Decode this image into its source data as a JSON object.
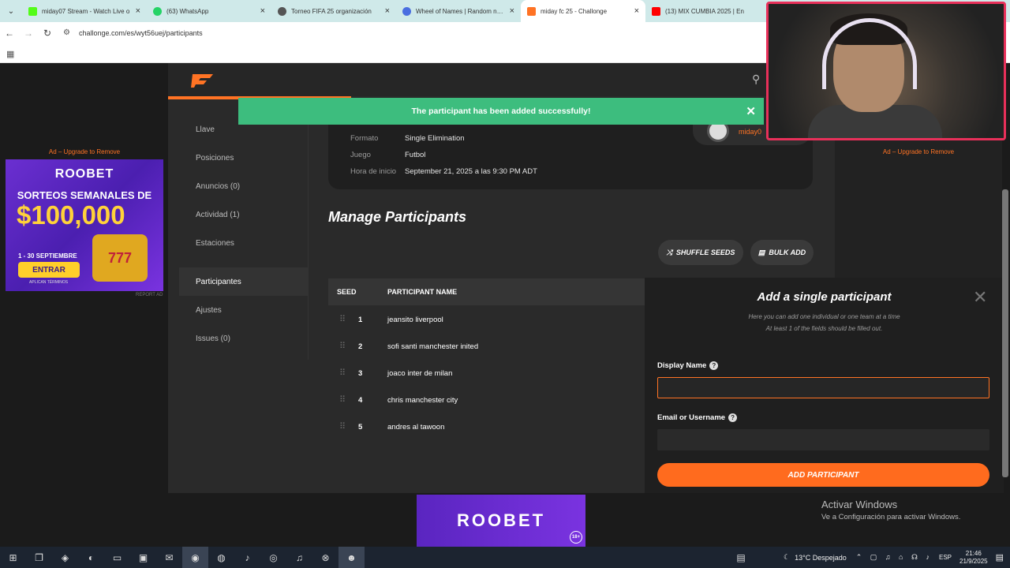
{
  "browser": {
    "tabs": [
      {
        "title": "miday07 Stream - Watch Live o",
        "color": "#53fc18"
      },
      {
        "title": "(63) WhatsApp",
        "color": "#25d366"
      },
      {
        "title": "Torneo FIFA 25 organización",
        "color": "#555555"
      },
      {
        "title": "Wheel of Names | Random nam",
        "color": "#4a6ee0"
      },
      {
        "title": "miday fc 25 - Challonge",
        "color": "#ff7324"
      },
      {
        "title": "(13) MIX CUMBIA 2025 | En",
        "color": "#ff0000"
      }
    ],
    "url": "challonge.com/es/wyt56uej/participants"
  },
  "toast": {
    "message": "The participant has been added successfully!"
  },
  "sidebar": {
    "items": [
      {
        "label": "Llave"
      },
      {
        "label": "Posiciones"
      },
      {
        "label": "Anuncios (0)"
      },
      {
        "label": "Actividad (1)"
      },
      {
        "label": "Estaciones"
      },
      {
        "label": "Participantes"
      },
      {
        "label": "Ajustes"
      },
      {
        "label": "Issues (0)"
      }
    ]
  },
  "tournament": {
    "formato_label": "Formato",
    "formato_value": "Single Elimination",
    "juego_label": "Juego",
    "juego_value": "Futbol",
    "hora_label": "Hora de inicio",
    "hora_value": "September 21, 2025 a las 9:30 PM ADT",
    "host_name": "miday0"
  },
  "manage": {
    "title": "Manage Participants",
    "shuffle_label": "SHUFFLE SEEDS",
    "bulk_label": "BULK ADD",
    "col_seed": "SEED",
    "col_name": "PARTICIPANT NAME",
    "participants": [
      {
        "seed": "1",
        "name": "jeansito liverpool"
      },
      {
        "seed": "2",
        "name": "sofi santi manchester inited"
      },
      {
        "seed": "3",
        "name": "joaco inter de milan"
      },
      {
        "seed": "4",
        "name": "chris manchester city"
      },
      {
        "seed": "5",
        "name": "andres al tawoon"
      }
    ]
  },
  "add_panel": {
    "title": "Add a single participant",
    "sub1": "Here you can add one individual or one team at a time",
    "sub2": "At least 1 of the fields should be filled out.",
    "display_name_label": "Display Name",
    "display_name_value": "",
    "email_label": "Email or Username",
    "email_value": "",
    "button": "ADD PARTICIPANT"
  },
  "ads": {
    "left_label": "Ad – Upgrade to Remove",
    "right_label": "Ad – Upgrade to Remove",
    "brand": "ROOBET",
    "headline": "SORTEOS SEMANALES DE",
    "amount": "$100,000",
    "dates": "1 - 30 SEPTIEMBRE",
    "cta": "ENTRAR",
    "terms": "APLICAN TÉRMINOS",
    "slot": "777",
    "report": "REPORT AD",
    "bottom_brand": "ROOBET",
    "age": "18+"
  },
  "windows": {
    "activate_title": "Activar Windows",
    "activate_sub": "Ve a Configuración para activar Windows."
  },
  "taskbar": {
    "weather": "13°C  Despejado",
    "lang": "ESP",
    "time": "21:46",
    "date": "21/9/2025"
  }
}
